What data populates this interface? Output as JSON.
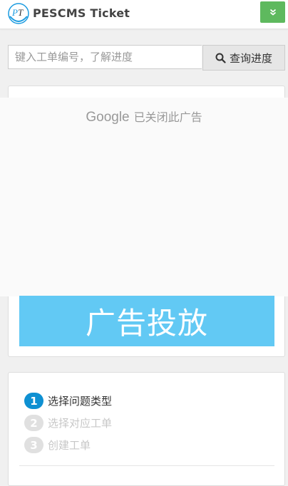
{
  "header": {
    "brand": "PESCMS Ticket",
    "logo_text": "PT",
    "menu_icon": "double-chevron-down-icon",
    "accent_color": "#5eb95e"
  },
  "search": {
    "placeholder": "键入工单编号，了解进度",
    "button_label": "查询进度",
    "button_icon": "search-icon"
  },
  "ad": {
    "closed_brand": "Google",
    "closed_text": "已关闭此广告",
    "banner_text": "广告投放",
    "banner_color": "#62c9f4"
  },
  "steps": [
    {
      "num": "1",
      "label": "选择问题类型",
      "state": "active"
    },
    {
      "num": "2",
      "label": "选择对应工单",
      "state": "inactive"
    },
    {
      "num": "3",
      "label": "创建工单",
      "state": "inactive"
    }
  ],
  "colors": {
    "step_active": "#0e90d2",
    "step_inactive": "#e0e0e0"
  }
}
